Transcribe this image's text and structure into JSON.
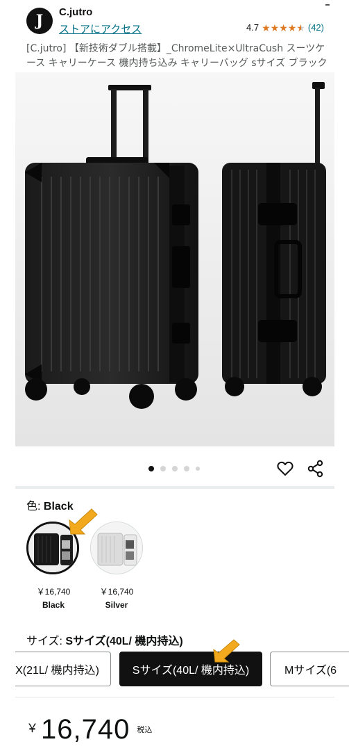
{
  "header": {
    "logo_letter": "J",
    "brand": "C.jutro",
    "store_link": "ストアにアクセス",
    "rating_value": "4.7",
    "rating_stars": 4.7,
    "review_count": "(42)"
  },
  "product": {
    "title": "[C.jutro] 【新技術ダブル搭載】_ChromeLite×UltraCush スーツケース キャリーケース 機内持ち込み キャリーバッグ sサイズ ブラック"
  },
  "gallery": {
    "image_count": 5,
    "active_index": 0
  },
  "icons": {
    "favorite": "heart-icon",
    "share": "share-icon"
  },
  "color": {
    "label": "色:",
    "selected": "Black",
    "options": [
      {
        "price": "￥16,740",
        "name": "Black"
      },
      {
        "price": "￥16,740",
        "name": "Silver"
      }
    ]
  },
  "size": {
    "label": "サイズ:",
    "selected": "Sサイズ(40L/ 機内持込)",
    "options": [
      "X(21L/ 機内持込)",
      "Sサイズ(40L/ 機内持込)",
      "Mサイズ(6"
    ]
  },
  "price": {
    "symbol": "￥",
    "value": "16,740",
    "tax": "税込"
  },
  "colors": {
    "link": "#007185",
    "star": "#de7921",
    "selected_bg": "#111111",
    "arrow": "#f2a91e"
  }
}
